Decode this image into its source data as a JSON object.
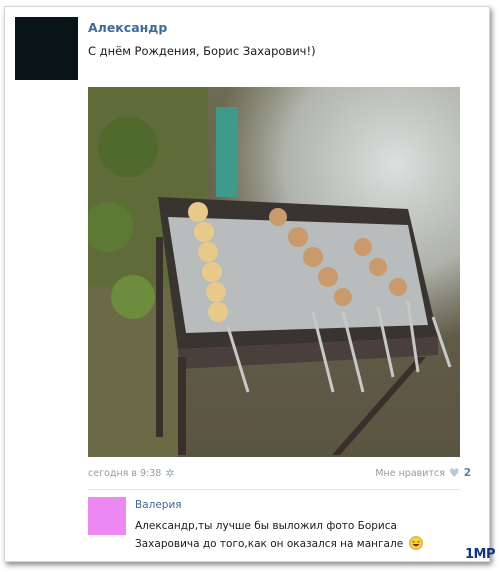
{
  "post": {
    "author": "Александр",
    "text": "С днём Рождения, Борис Захарович!)",
    "photo_description_icon": "grill-photo",
    "time": "сегодня в 9:38",
    "likes_label": "Мне нравится",
    "likes_count": "2"
  },
  "comment": {
    "author": "Валерия",
    "text": "Александр,ты лучше бы выложил фото Бориса Захаровича до того,как он оказался на мангале",
    "emoji": "laughing-smiley-icon"
  },
  "watermark": "1MP",
  "colors": {
    "link": "#3e6a95",
    "post_avatar": "#081415",
    "comment_avatar": "#ee88f2",
    "watermark": "#13367d"
  }
}
